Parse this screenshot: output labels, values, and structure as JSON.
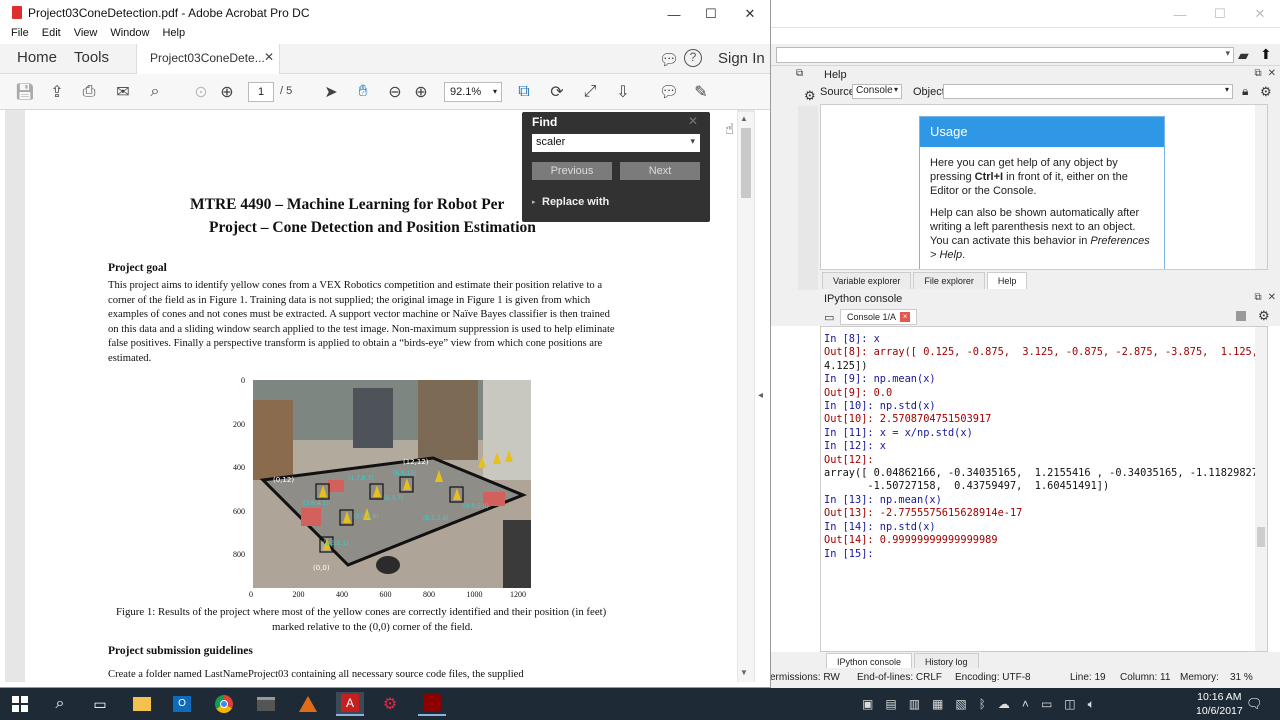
{
  "acrobat": {
    "window_title": "Project03ConeDetection.pdf - Adobe Acrobat Pro DC",
    "menu": [
      "File",
      "Edit",
      "View",
      "Window",
      "Help"
    ],
    "nav": {
      "home": "Home",
      "tools": "Tools",
      "doc_tab": "Project03ConeDete...",
      "sign_in": "Sign In"
    },
    "page_current": "1",
    "page_total": "/ 5",
    "zoom": "92.1%"
  },
  "find": {
    "title": "Find",
    "query": "scaler",
    "previous": "Previous",
    "next": "Next",
    "replace": "Replace with"
  },
  "doc": {
    "title_line1": "MTRE 4490 – Machine Learning for Robot Per",
    "title_line2": "Project – Cone Detection and Position Estimation",
    "goal_heading": "Project goal",
    "goal_lines": [
      "This project aims to identify yellow cones from a VEX Robotics competition and estimate their position relative to a",
      "corner of the field as in Figure 1. Training data is not supplied; the original image in Figure 1 is given from which",
      "examples of cones and not cones must be extracted. A support vector machine or Naïve Bayes classifier is then trained",
      "on this data and a sliding window search applied to the test image. Non-maximum suppression is used to help eliminate",
      "false positives. Finally a perspective transform is applied to obtain a “birds-eye” view from which cone positions are",
      "estimated."
    ],
    "fig_y_ticks": [
      "0",
      "200",
      "400",
      "600",
      "800"
    ],
    "fig_x_ticks": [
      "0",
      "200",
      "400",
      "600",
      "800",
      "1000",
      "1200"
    ],
    "fig_labels": [
      "(12,12)",
      "(0,12)",
      "(0,0)"
    ],
    "caption_line1": "Figure 1: Results of the project where most of the yellow cones are correctly identified and their position (in feet)",
    "caption_line2": "marked relative to the (0,0) corner of the field.",
    "submission_heading": "Project submission guidelines",
    "submission_line": "Create   a   folder   named   LastNameProject03   containing   all   necessary   source   code   files,   the   supplied"
  },
  "spyder": {
    "help_pane": "Help",
    "source_label": "Source",
    "source_value": "Console",
    "object_label": "Object",
    "usage_title": "Usage",
    "usage_p1_a": "Here you can get help of any object by pressing ",
    "usage_p1_b": "Ctrl+I",
    "usage_p1_c": " in front of it, either on the Editor or the Console.",
    "usage_p2_a": "Help can also be shown automatically after writing a left parenthesis next to an object. You can activate this behavior in ",
    "usage_p2_b": "Preferences > Help",
    "usage_p2_c": ".",
    "help_tabs": [
      "Variable explorer",
      "File explorer",
      "Help"
    ],
    "ipython_pane": "IPython console",
    "console_tab": "Console 1/A",
    "console_lines": [
      {
        "t": "in",
        "s": "In [8]: x"
      },
      {
        "t": "out",
        "s": "Out[8]: array([ 0.125, -0.875,  3.125, -0.875, -2.875, -3.875,  1.125,"
      },
      {
        "t": "plain",
        "s": "4.125])"
      },
      {
        "t": "blank",
        "s": ""
      },
      {
        "t": "in",
        "s": "In [9]: np.mean(x)"
      },
      {
        "t": "out",
        "s": "Out[9]: 0.0"
      },
      {
        "t": "blank",
        "s": ""
      },
      {
        "t": "in",
        "s": "In [10]: np.std(x)"
      },
      {
        "t": "out",
        "s": "Out[10]: 2.5708704751503917"
      },
      {
        "t": "blank",
        "s": ""
      },
      {
        "t": "in",
        "s": "In [11]: x = x/np.std(x)"
      },
      {
        "t": "blank",
        "s": ""
      },
      {
        "t": "in",
        "s": "In [12]: x"
      },
      {
        "t": "out",
        "s": "Out[12]:"
      },
      {
        "t": "plain",
        "s": "array([ 0.04862166, -0.34035165,  1.2155416 , -0.34035165, -1.11829827,"
      },
      {
        "t": "plain",
        "s": "       -1.50727158,  0.43759497,  1.60451491])"
      },
      {
        "t": "blank",
        "s": ""
      },
      {
        "t": "in",
        "s": "In [13]: np.mean(x)"
      },
      {
        "t": "out",
        "s": "Out[13]: -2.7755575615628914e-17"
      },
      {
        "t": "blank",
        "s": ""
      },
      {
        "t": "in",
        "s": "In [14]: np.std(x)"
      },
      {
        "t": "out",
        "s": "Out[14]: 0.99999999999999989"
      },
      {
        "t": "blank",
        "s": ""
      },
      {
        "t": "in",
        "s": "In [15]:"
      }
    ],
    "bottom_tabs": [
      "IPython console",
      "History log"
    ],
    "status": {
      "perm": "ermissions: RW",
      "eol": "End-of-lines: CRLF",
      "enc": "Encoding: UTF-8",
      "line": "Line: 19",
      "col": "Column: 11",
      "mem": "Memory:",
      "mem_val": "31 %"
    }
  },
  "taskbar": {
    "time": "10:16 AM",
    "date": "10/6/2017"
  }
}
